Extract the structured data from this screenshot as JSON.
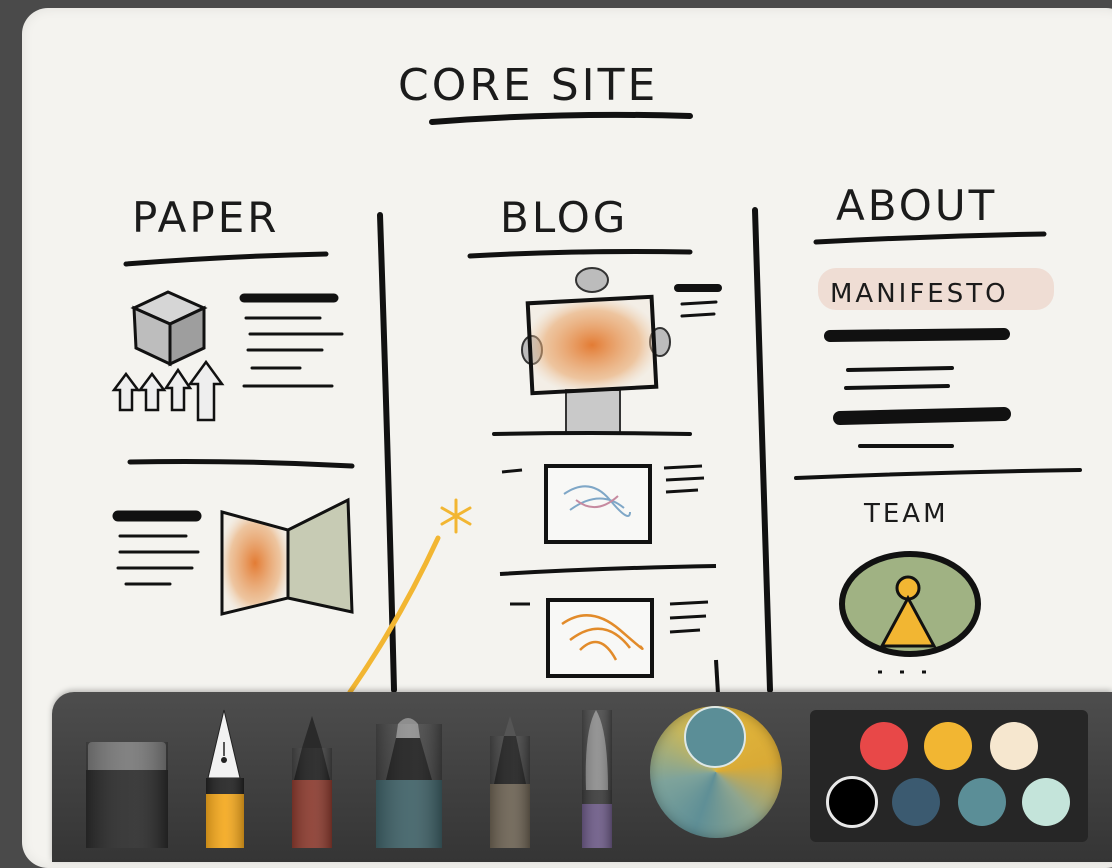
{
  "sketch": {
    "title": "CORE SITE",
    "columns": [
      {
        "heading": "PAPER"
      },
      {
        "heading": "BLOG"
      },
      {
        "heading": "ABOUT"
      }
    ],
    "about_items": {
      "highlight": "MANIFESTO",
      "team": "TEAM"
    }
  },
  "toolbar": {
    "tools": [
      {
        "name": "eraser",
        "color": "#2b2b2b"
      },
      {
        "name": "fountain-pen",
        "color": "#f4a81d"
      },
      {
        "name": "pencil",
        "color": "#8a3a2e"
      },
      {
        "name": "marker",
        "color": "#3e6066"
      },
      {
        "name": "fine-pen",
        "color": "#6b6152"
      },
      {
        "name": "brush",
        "color": "#6c5a86"
      }
    ],
    "colors": {
      "current": "#5b8e97",
      "swatches": [
        "#e84848",
        "#f2b632",
        "#f6e7cf",
        "#000000",
        "#3b5a70",
        "#5b8e97",
        "#c4e4da"
      ],
      "selected_swatch": "#000000"
    }
  }
}
